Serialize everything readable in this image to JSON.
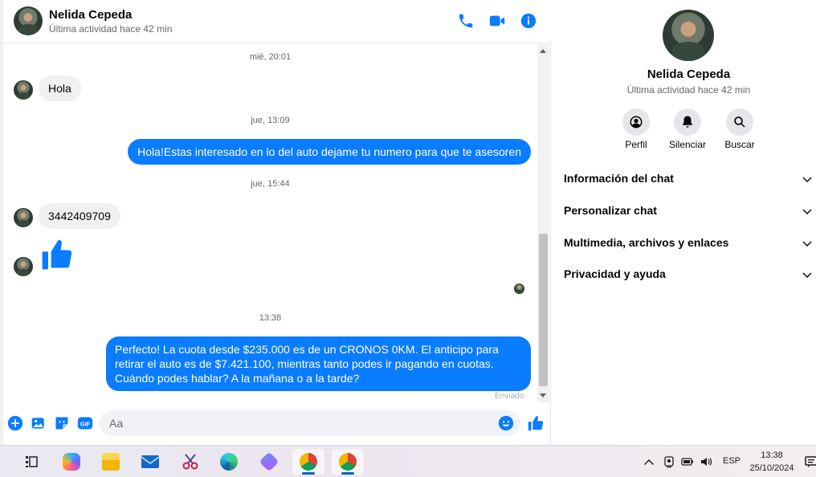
{
  "chat": {
    "contact_name": "Nelida Cepeda",
    "contact_status": "Última actividad hace 42 min",
    "header_icons": [
      "phone-icon",
      "video-icon",
      "info-icon"
    ]
  },
  "messages": [
    {
      "kind": "time",
      "text": "mié, 20:01"
    },
    {
      "kind": "in",
      "text": "Hola"
    },
    {
      "kind": "time",
      "text": "jue, 13:09"
    },
    {
      "kind": "out",
      "text": "Hola!Estas interesado en lo del auto dejame tu numero para que te asesoren"
    },
    {
      "kind": "time",
      "text": "jue, 15:44"
    },
    {
      "kind": "in",
      "text": "3442409709"
    },
    {
      "kind": "in-like",
      "icon": "thumbs-up-icon"
    },
    {
      "kind": "time",
      "text": "13:38"
    },
    {
      "kind": "out",
      "text": "Perfecto! La cuota desde $235.000 es de un CRONOS 0KM. El anticipo para retirar el auto es de $7.421.100, mientras tanto podes ir pagando en cuotas. Cuándo podes hablar? A la mañana o a la tarde?"
    },
    {
      "kind": "status",
      "text": "Enviado"
    }
  ],
  "composer": {
    "placeholder": "Aa",
    "icons": [
      "plus-icon",
      "image-icon",
      "sticker-icon",
      "gif-icon",
      "emoji-icon",
      "like-icon"
    ],
    "gif_label": "GIF"
  },
  "info": {
    "name": "Nelida Cepeda",
    "status": "Última actividad hace 42 min",
    "actions": [
      {
        "label": "Perfil",
        "icon": "profile-icon"
      },
      {
        "label": "Silenciar",
        "icon": "bell-icon"
      },
      {
        "label": "Buscar",
        "icon": "search-icon"
      }
    ],
    "sections": [
      {
        "title": "Información del chat"
      },
      {
        "title": "Personalizar chat"
      },
      {
        "title": "Multimedia, archivos y enlaces"
      },
      {
        "title": "Privacidad y ayuda"
      }
    ]
  },
  "taskbar": {
    "apps": [
      "task-view-icon",
      "copilot-icon",
      "file-explorer-icon",
      "mail-icon",
      "snipping-tool-icon",
      "edge-icon",
      "app-icon",
      "chrome-profile-icon",
      "chrome-b-icon"
    ],
    "language": "ESP",
    "time": "13:38",
    "date": "25/10/2024"
  }
}
